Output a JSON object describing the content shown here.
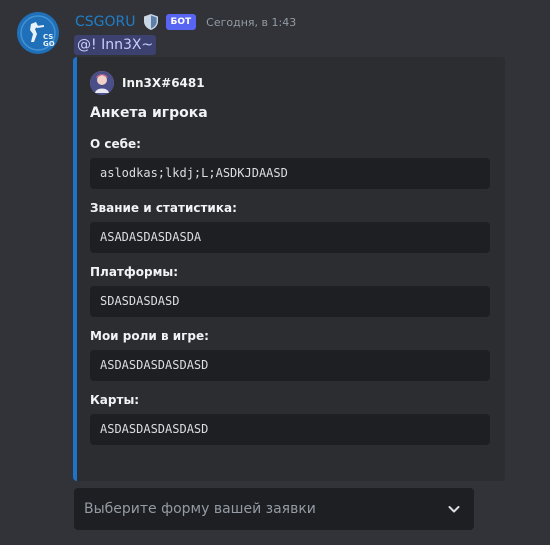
{
  "message": {
    "author": "CSGORU",
    "author_color": "#1f7fc9",
    "bot_tag": "БОТ",
    "timestamp": "Сегодня, в 1:43",
    "mention": "@! Inn3X~"
  },
  "embed": {
    "accent_color": "#1e73c9",
    "author_name": "Inn3X#6481",
    "title": "Анкета игрока",
    "fields": [
      {
        "name": "О себе:",
        "value": "aslodkas;lkdj;L;ASDKJDAASD"
      },
      {
        "name": "Звание и статистика:",
        "value": "ASADASDASDASDA"
      },
      {
        "name": "Платформы:",
        "value": "SDASDASDASD"
      },
      {
        "name": "Мои роли в игре:",
        "value": "ASDASDASDASDASD"
      },
      {
        "name": "Карты:",
        "value": "ASDASDASDASDASD"
      }
    ]
  },
  "select_menu": {
    "placeholder": "Выберите форму вашей заявки"
  },
  "icons": {
    "avatar": "csgo-logo-avatar-icon",
    "verified": "shield-icon",
    "dropdown": "chevron-down-icon"
  }
}
